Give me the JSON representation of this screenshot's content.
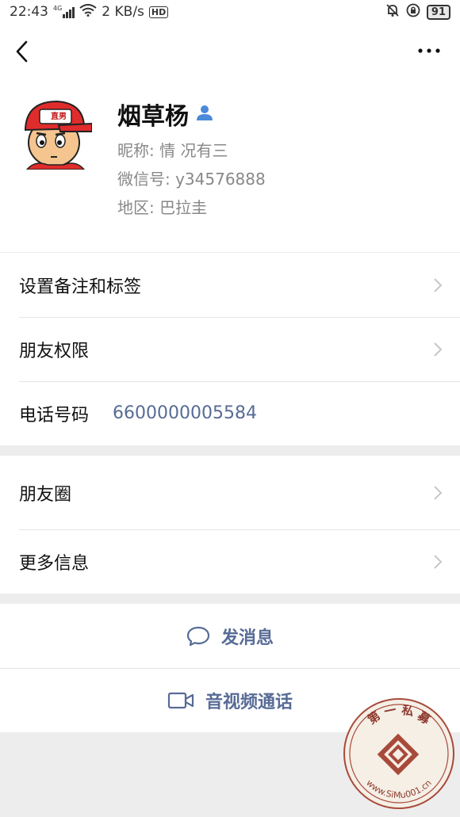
{
  "status_bar": {
    "time": "22:43",
    "signal": "4G",
    "speed": "2 KB/s",
    "hd": "HD",
    "battery": "91"
  },
  "profile": {
    "avatar_text": "直男",
    "name": "烟草杨",
    "nickname": "昵称: 情 况有三",
    "wechat_id": "微信号: y34576888",
    "region": "地区: 巴拉圭"
  },
  "section1": {
    "remark_label": "设置备注和标签",
    "permission_label": "朋友权限",
    "phone_label": "电话号码",
    "phone_value": "6600000005584"
  },
  "section2": {
    "moments_label": "朋友圈",
    "more_info_label": "更多信息"
  },
  "actions": {
    "message_label": "发消息",
    "call_label": "音视频通话"
  },
  "watermark": {
    "text_top": "第 一 私 募",
    "text_bottom": "www.SiMu001.cn"
  },
  "colors": {
    "link": "#576b95",
    "background": "#ededed"
  }
}
